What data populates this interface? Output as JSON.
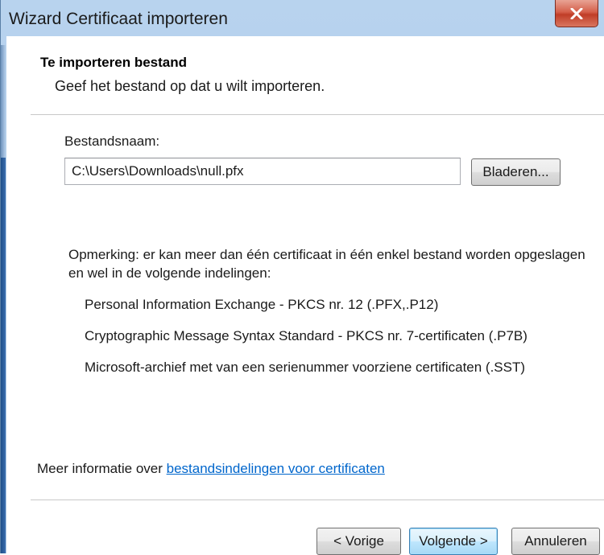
{
  "window": {
    "title": "Wizard Certificaat importeren"
  },
  "header": {
    "title": "Te importeren bestand",
    "subtitle": "Geef het bestand op dat u wilt importeren."
  },
  "file": {
    "label": "Bestandsnaam:",
    "value": "C:\\Users\\Downloads\\null.pfx",
    "browse_label": "Bladeren..."
  },
  "note": {
    "text": "Opmerking: er kan meer dan één certificaat in één enkel bestand worden opgeslagen en wel in de volgende indelingen:"
  },
  "formats": [
    "Personal Information Exchange - PKCS nr. 12 (.PFX,.P12)",
    "Cryptographic Message Syntax Standard - PKCS nr. 7-certificaten (.P7B)",
    "Microsoft-archief met van een serienummer voorziene certificaten (.SST)"
  ],
  "info": {
    "prefix": "Meer informatie over ",
    "link": "bestandsindelingen voor certificaten"
  },
  "footer": {
    "prev_label": "< Vorige",
    "next_label": "Volgende >",
    "cancel_label": "Annuleren"
  },
  "icons": {
    "close": "close-icon"
  },
  "colors": {
    "link": "#0066cc",
    "close_button": "#c03d27",
    "title_bar": "#b8d3ee"
  }
}
